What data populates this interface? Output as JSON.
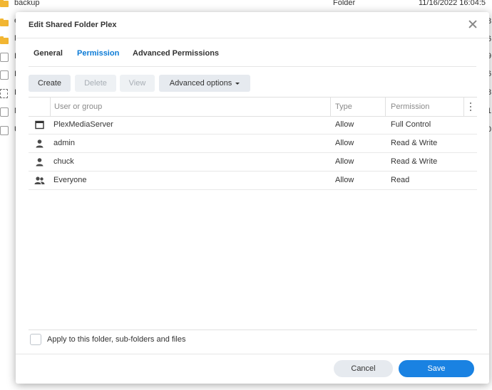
{
  "background_list": {
    "first_row": {
      "name": "backup",
      "type": "Folder",
      "date": "11/16/2022 16:04:5"
    },
    "rows": [
      {
        "icon": "folder-icon",
        "name": "e",
        "trail": "8"
      },
      {
        "icon": "folder-icon",
        "name": "N",
        "trail": "6"
      },
      {
        "icon": "file-icon",
        "name": "I",
        "trail": "9"
      },
      {
        "icon": "file-icon",
        "name": "I",
        "trail": "6"
      },
      {
        "icon": "dotted-file-icon",
        "name": "I",
        "trail": "8"
      },
      {
        "icon": "file-icon",
        "name": "N",
        "trail": "1"
      },
      {
        "icon": "file-icon",
        "name": "U",
        "trail": "0"
      }
    ]
  },
  "dialog": {
    "title": "Edit Shared Folder Plex",
    "tabs": [
      {
        "label": "General",
        "active": false
      },
      {
        "label": "Permission",
        "active": true
      },
      {
        "label": "Advanced Permissions",
        "active": false
      }
    ],
    "toolbar": {
      "create": "Create",
      "delete": "Delete",
      "view": "View",
      "advanced_options": "Advanced options"
    },
    "table": {
      "columns": [
        "User or group",
        "Type",
        "Permission"
      ],
      "rows": [
        {
          "icon": "application-window-icon",
          "name": "PlexMediaServer",
          "type": "Allow",
          "permission": "Full Control"
        },
        {
          "icon": "user-icon",
          "name": "admin",
          "type": "Allow",
          "permission": "Read & Write"
        },
        {
          "icon": "user-icon",
          "name": "chuck",
          "type": "Allow",
          "permission": "Read & Write"
        },
        {
          "icon": "group-icon",
          "name": "Everyone",
          "type": "Allow",
          "permission": "Read"
        }
      ]
    },
    "apply_label": "Apply to this folder, sub-folders and files",
    "apply_checked": false,
    "buttons": {
      "cancel": "Cancel",
      "save": "Save"
    }
  },
  "colors": {
    "accent": "#1a82e2",
    "tab_active": "#0a7ad6",
    "folder": "#f2b632"
  }
}
